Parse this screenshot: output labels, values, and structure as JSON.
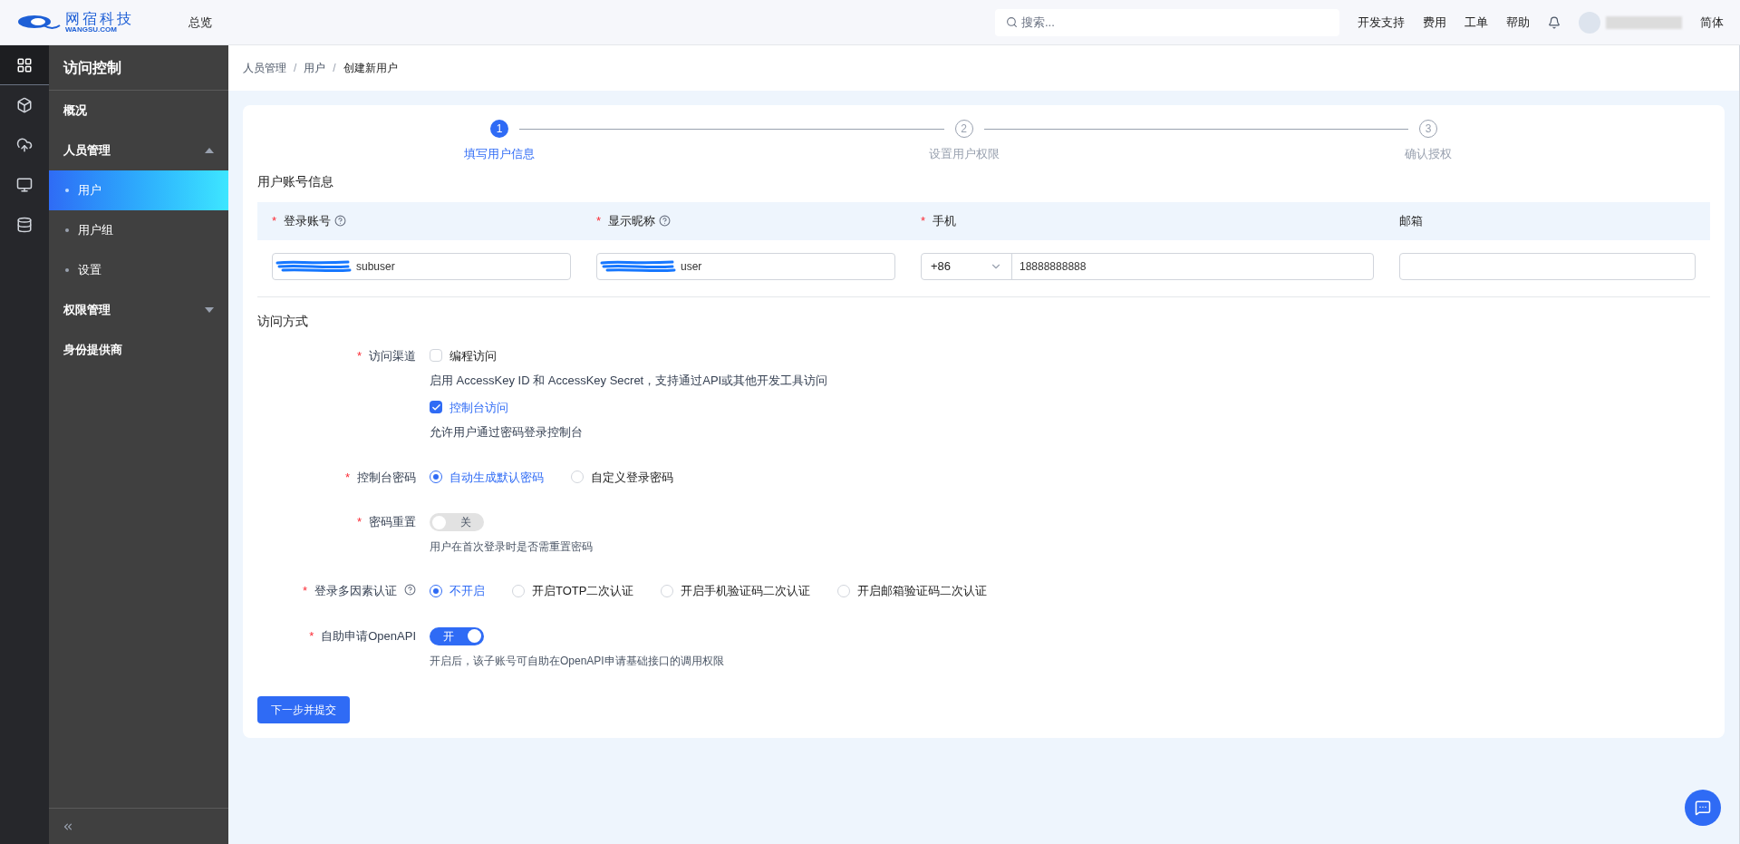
{
  "header": {
    "logo": {
      "name": "网宿科技",
      "domain": "WANGSU.COM"
    },
    "nav": "总览",
    "search": {
      "placeholder": "搜索..."
    },
    "links": [
      "开发支持",
      "费用",
      "工单",
      "帮助"
    ],
    "language": "简体"
  },
  "rail": [
    {
      "kind": "grid",
      "selected": true
    },
    {
      "kind": "box",
      "selected": false
    },
    {
      "kind": "cloud-up",
      "selected": false
    },
    {
      "kind": "monitor",
      "selected": false
    },
    {
      "kind": "cloud-db",
      "selected": false
    }
  ],
  "sidebar": {
    "title": "访问控制",
    "items": [
      {
        "label": "概况",
        "selected": false
      },
      {
        "label": "人员管理",
        "expanded": true,
        "children": [
          {
            "label": "用户",
            "selected": true
          },
          {
            "label": "用户组",
            "selected": false
          },
          {
            "label": "设置",
            "selected": false
          }
        ]
      },
      {
        "label": "权限管理",
        "expanded": false
      },
      {
        "label": "身份提供商",
        "selected": false
      }
    ]
  },
  "breadcrumb": {
    "separator": "/",
    "items": [
      "人员管理",
      "用户",
      "创建新用户"
    ]
  },
  "steps": [
    {
      "number": "1",
      "label": "填写用户信息",
      "selected": true
    },
    {
      "number": "2",
      "label": "设置用户权限",
      "selected": false
    },
    {
      "number": "3",
      "label": "确认授权",
      "selected": false
    }
  ],
  "required_mark": "*",
  "account": {
    "title": "用户账号信息",
    "columns": [
      {
        "label": "登录账号",
        "required": true,
        "help": true
      },
      {
        "label": "显示昵称",
        "required": true,
        "help": true
      },
      {
        "label": "手机",
        "required": true,
        "help": false
      },
      {
        "label": "邮箱",
        "required": false,
        "help": false
      }
    ],
    "fields": [
      {
        "kind": "text",
        "value": "subuser",
        "redacted": true
      },
      {
        "kind": "text",
        "value": "user",
        "redacted": true
      },
      {
        "kind": "phone",
        "code": "+86",
        "value": "18888888888"
      },
      {
        "kind": "text",
        "redacted": false
      }
    ]
  },
  "access": {
    "title": "访问方式",
    "rows": [
      {
        "kind": "checkboxes",
        "label": "访问渠道",
        "required": true,
        "help": false,
        "options": [
          {
            "label": "编程访问",
            "checked": false,
            "hint": "启用 AccessKey ID 和 AccessKey Secret，支持通过API或其他开发工具访问"
          },
          {
            "label": "控制台访问",
            "checked": true,
            "hint": "允许用户通过密码登录控制台"
          }
        ]
      },
      {
        "kind": "radio",
        "label": "控制台密码",
        "required": true,
        "help": false,
        "options": [
          {
            "label": "自动生成默认密码",
            "selected": true
          },
          {
            "label": "自定义登录密码",
            "selected": false
          }
        ]
      },
      {
        "kind": "switch",
        "label": "密码重置",
        "required": true,
        "help": false,
        "on": false,
        "text": "关",
        "hint": "用户在首次登录时是否需重置密码"
      },
      {
        "kind": "radio",
        "label": "登录多因素认证",
        "required": true,
        "help": true,
        "options": [
          {
            "label": "不开启",
            "selected": true
          },
          {
            "label": "开启TOTP二次认证",
            "selected": false
          },
          {
            "label": "开启手机验证码二次认证",
            "selected": false
          },
          {
            "label": "开启邮箱验证码二次认证",
            "selected": false
          }
        ]
      },
      {
        "kind": "switch",
        "label": "自助申请OpenAPI",
        "required": true,
        "help": false,
        "on": true,
        "text": "开",
        "hint": "开启后，该子账号可自助在OpenAPI申请基础接口的调用权限"
      }
    ]
  },
  "submit": "下一步并提交"
}
